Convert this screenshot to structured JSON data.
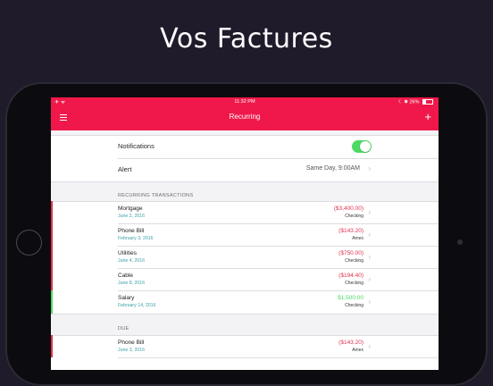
{
  "headline": "Vos Factures",
  "statusbar": {
    "left": "✈ ᯤ",
    "time": "11:32 PM",
    "battery_pct": "26%",
    "right_icons": "☾ ✱"
  },
  "navbar": {
    "title": "Recurring"
  },
  "settings": {
    "notifications_label": "Notifications",
    "notifications_on": true,
    "alert_label": "Alert",
    "alert_value": "Same Day, 9:00AM"
  },
  "recurring_header": "RECURRING TRANSACTIONS",
  "transactions": [
    {
      "name": "Mortgage",
      "date": "June 2, 2016",
      "amount": "($3,400.00)",
      "account": "Checking",
      "kind": "expense"
    },
    {
      "name": "Phone Bill",
      "date": "February 3, 2016",
      "amount": "($143.20)",
      "account": "Amex",
      "kind": "expense"
    },
    {
      "name": "Utilities",
      "date": "June 4, 2016",
      "amount": "($750.00)",
      "account": "Checking",
      "kind": "expense"
    },
    {
      "name": "Cable",
      "date": "June 8, 2016",
      "amount": "($194.40)",
      "account": "Checking",
      "kind": "expense"
    },
    {
      "name": "Salary",
      "date": "February 14, 2016",
      "amount": "$1,500.00",
      "account": "Checking",
      "kind": "income"
    }
  ],
  "due_header": "DUE",
  "due": [
    {
      "name": "Phone Bill",
      "date": "June 3, 2016",
      "amount": "($143.20)",
      "account": "Amex",
      "kind": "expense"
    }
  ],
  "colors": {
    "accent": "#f0184a",
    "expense": "#e0334f",
    "income": "#4cd964",
    "date": "#3aa0a8"
  }
}
